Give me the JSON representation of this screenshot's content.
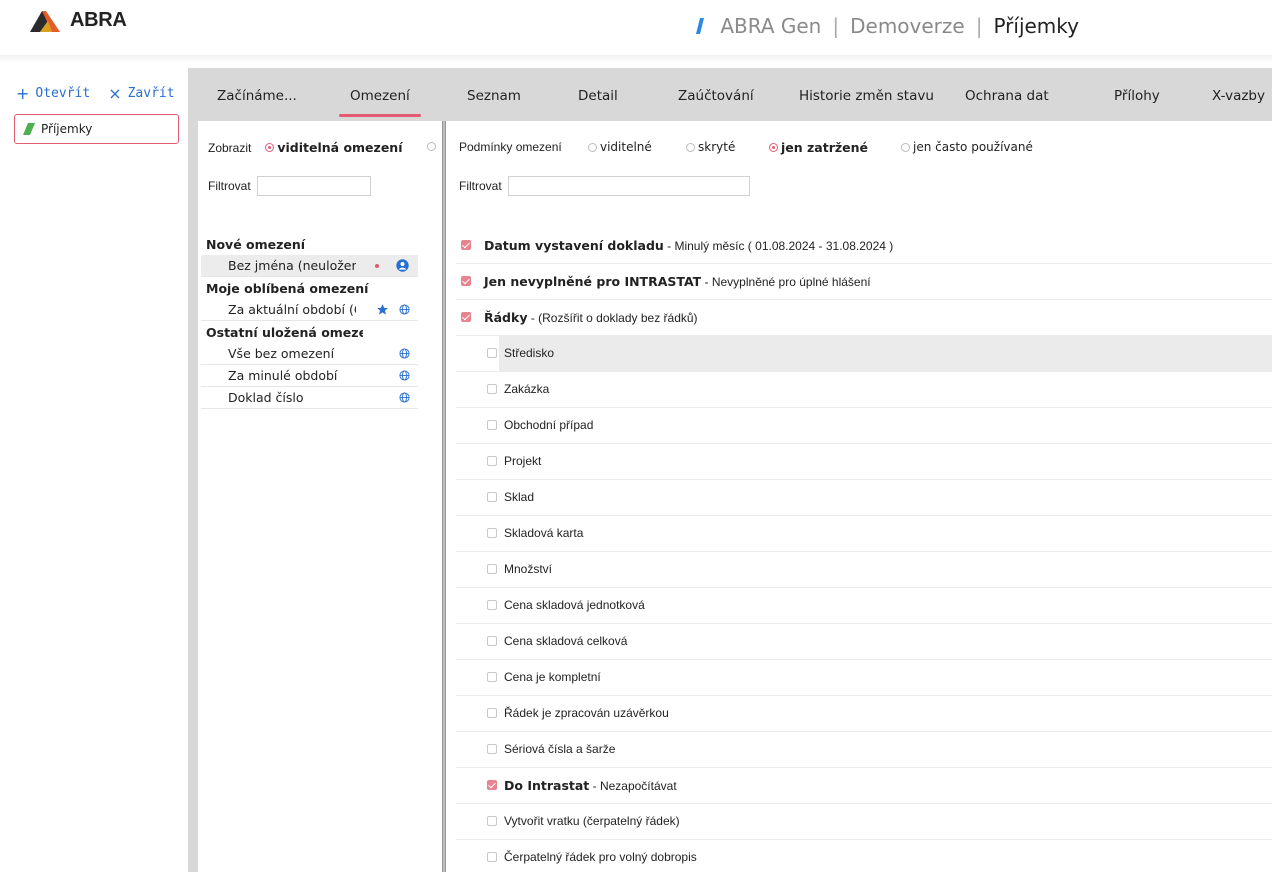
{
  "header": {
    "logo_text": "ABRA",
    "product": "ABRA Gen",
    "edition": "Demoverze",
    "module": "Příjemky",
    "separator": "|"
  },
  "leftnav": {
    "open_label": "Otevřít",
    "close_label": "Zavřít",
    "open_icon": "plus-icon",
    "close_icon": "close-icon",
    "document_tab": "Příjemky"
  },
  "tabs": [
    {
      "label": "Začínáme...",
      "active": false
    },
    {
      "label": "Omezení",
      "active": true
    },
    {
      "label": "Seznam",
      "active": false
    },
    {
      "label": "Detail",
      "active": false
    },
    {
      "label": "Zaúčtování",
      "active": false
    },
    {
      "label": "Historie změn stavu",
      "active": false
    },
    {
      "label": "Ochrana dat",
      "active": false
    },
    {
      "label": "Přílohy",
      "active": false
    },
    {
      "label": "X-vazby",
      "active": false
    }
  ],
  "saved_filters": {
    "show_label": "Zobrazit",
    "show_option": "viditelná omezení",
    "filter_label": "Filtrovat",
    "filter_value": "",
    "new_header": "Nové omezení",
    "new_items": [
      {
        "label": "Bez jména (neuložené)",
        "selected": true
      }
    ],
    "favorites_header": "Moje oblíbená omezení",
    "favorite_items": [
      {
        "label": "Za aktuální období (Ctrl"
      }
    ],
    "other_header": "Ostatní uložená omezen",
    "other_items": [
      {
        "label": "Vše bez omezení"
      },
      {
        "label": "Za minulé období"
      },
      {
        "label": "Doklad číslo"
      }
    ]
  },
  "conditions": {
    "label": "Podmínky omezení",
    "options": [
      {
        "label": "viditelné",
        "checked": false
      },
      {
        "label": "skryté",
        "checked": false
      },
      {
        "label": "jen zatržené",
        "checked": true
      },
      {
        "label": "jen často používané",
        "checked": false
      }
    ],
    "filter_label": "Filtrovat",
    "filter_value": "",
    "items": [
      {
        "title": "Datum vystavení dokladu",
        "detail": " - Minulý měsíc ( 01.08.2024 - 31.08.2024 )",
        "checked": true,
        "level": 0
      },
      {
        "title": "Jen nevyplněné pro INTRASTAT",
        "detail": " - Nevyplněné pro úplné hlášení",
        "checked": true,
        "level": 0
      },
      {
        "title": "Řádky",
        "detail": " - (Rozšířit o doklady bez řádků)",
        "checked": true,
        "level": 0
      },
      {
        "title": "Středisko",
        "detail": "",
        "checked": false,
        "level": 1,
        "highlight": true
      },
      {
        "title": "Zakázka",
        "detail": "",
        "checked": false,
        "level": 1
      },
      {
        "title": "Obchodní případ",
        "detail": "",
        "checked": false,
        "level": 1
      },
      {
        "title": "Projekt",
        "detail": "",
        "checked": false,
        "level": 1
      },
      {
        "title": "Sklad",
        "detail": "",
        "checked": false,
        "level": 1
      },
      {
        "title": "Skladová karta",
        "detail": "",
        "checked": false,
        "level": 1
      },
      {
        "title": "Množství",
        "detail": "",
        "checked": false,
        "level": 1
      },
      {
        "title": "Cena skladová jednotková",
        "detail": "",
        "checked": false,
        "level": 1
      },
      {
        "title": "Cena skladová celková",
        "detail": "",
        "checked": false,
        "level": 1
      },
      {
        "title": "Cena je kompletní",
        "detail": "",
        "checked": false,
        "level": 1
      },
      {
        "title": "Řádek je zpracován uzávěrkou",
        "detail": "",
        "checked": false,
        "level": 1
      },
      {
        "title": "Sériová čísla a šarže",
        "detail": "",
        "checked": false,
        "level": 1
      },
      {
        "title": "Do Intrastat",
        "detail": " - Nezapočítávat",
        "checked": true,
        "level": 1
      },
      {
        "title": "Vytvořit vratku (čerpatelný řádek)",
        "detail": "",
        "checked": false,
        "level": 1
      },
      {
        "title": "Čerpatelný řádek pro volný dobropis",
        "detail": "",
        "checked": false,
        "level": 1
      }
    ]
  },
  "colors": {
    "accent": "#e35b73",
    "link": "#2a6fd0",
    "tabbar": "#d8d8d8",
    "checked": "#e8838f"
  }
}
